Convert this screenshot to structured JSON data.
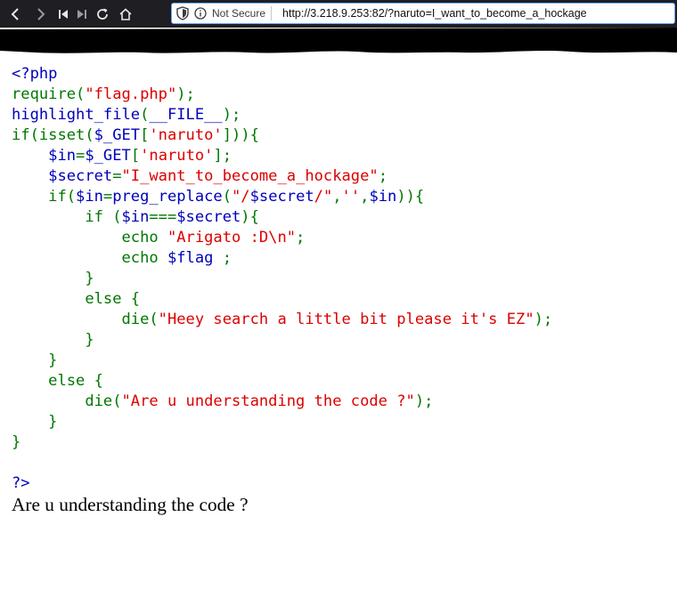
{
  "browser": {
    "security_label": "Not Secure",
    "url": "http://3.218.9.253:82/?naruto=I_want_to_become_a_hockage",
    "icons": [
      "back-icon",
      "forward-icon",
      "skip-back-icon",
      "skip-forward-icon",
      "reload-icon",
      "home-icon",
      "shield-icon",
      "info-icon"
    ],
    "colors": {
      "toolbar": "#1f1f23",
      "url_border": "#6aa7ff",
      "redaction": "#000000"
    }
  },
  "source": {
    "colors": {
      "keyword": "#007700",
      "default": "#0000bb",
      "string": "#dd0000"
    },
    "lines": [
      [
        {
          "t": "<?php",
          "c": "def"
        }
      ],
      [
        {
          "t": "require(",
          "c": "kw"
        },
        {
          "t": "\"flag.php\"",
          "c": "str"
        },
        {
          "t": ");",
          "c": "kw"
        }
      ],
      [
        {
          "t": "highlight_file",
          "c": "def"
        },
        {
          "t": "(",
          "c": "kw"
        },
        {
          "t": "__FILE__",
          "c": "def"
        },
        {
          "t": ");",
          "c": "kw"
        }
      ],
      [
        {
          "t": "if(isset(",
          "c": "kw"
        },
        {
          "t": "$_GET",
          "c": "def"
        },
        {
          "t": "[",
          "c": "kw"
        },
        {
          "t": "'naruto'",
          "c": "str"
        },
        {
          "t": "])){",
          "c": "kw"
        }
      ],
      [
        {
          "t": "    ",
          "c": "kw"
        },
        {
          "t": "$in",
          "c": "def"
        },
        {
          "t": "=",
          "c": "kw"
        },
        {
          "t": "$_GET",
          "c": "def"
        },
        {
          "t": "[",
          "c": "kw"
        },
        {
          "t": "'naruto'",
          "c": "str"
        },
        {
          "t": "];",
          "c": "kw"
        }
      ],
      [
        {
          "t": "    ",
          "c": "kw"
        },
        {
          "t": "$secret",
          "c": "def"
        },
        {
          "t": "=",
          "c": "kw"
        },
        {
          "t": "\"I_want_to_become_a_hockage\"",
          "c": "str"
        },
        {
          "t": ";",
          "c": "kw"
        }
      ],
      [
        {
          "t": "    if(",
          "c": "kw"
        },
        {
          "t": "$in",
          "c": "def"
        },
        {
          "t": "=",
          "c": "kw"
        },
        {
          "t": "preg_replace",
          "c": "def"
        },
        {
          "t": "(",
          "c": "kw"
        },
        {
          "t": "\"/",
          "c": "str"
        },
        {
          "t": "$secret",
          "c": "def"
        },
        {
          "t": "/\"",
          "c": "str"
        },
        {
          "t": ",",
          "c": "kw"
        },
        {
          "t": "''",
          "c": "str"
        },
        {
          "t": ",",
          "c": "kw"
        },
        {
          "t": "$in",
          "c": "def"
        },
        {
          "t": ")){",
          "c": "kw"
        }
      ],
      [
        {
          "t": "        if (",
          "c": "kw"
        },
        {
          "t": "$in",
          "c": "def"
        },
        {
          "t": "===",
          "c": "kw"
        },
        {
          "t": "$secret",
          "c": "def"
        },
        {
          "t": "){",
          "c": "kw"
        }
      ],
      [
        {
          "t": "            echo ",
          "c": "kw"
        },
        {
          "t": "\"Arigato :D\\n\"",
          "c": "str"
        },
        {
          "t": ";",
          "c": "kw"
        }
      ],
      [
        {
          "t": "            echo ",
          "c": "kw"
        },
        {
          "t": "$flag ",
          "c": "def"
        },
        {
          "t": ";",
          "c": "kw"
        }
      ],
      [
        {
          "t": "        }",
          "c": "kw"
        }
      ],
      [
        {
          "t": "        else {",
          "c": "kw"
        }
      ],
      [
        {
          "t": "            die(",
          "c": "kw"
        },
        {
          "t": "\"Heey search a little bit please it's EZ\"",
          "c": "str"
        },
        {
          "t": ");",
          "c": "kw"
        }
      ],
      [
        {
          "t": "        }",
          "c": "kw"
        }
      ],
      [
        {
          "t": "    }",
          "c": "kw"
        }
      ],
      [
        {
          "t": "    else {",
          "c": "kw"
        }
      ],
      [
        {
          "t": "        die(",
          "c": "kw"
        },
        {
          "t": "\"Are u understanding the code ?\"",
          "c": "str"
        },
        {
          "t": ");",
          "c": "kw"
        }
      ],
      [
        {
          "t": "    }",
          "c": "kw"
        }
      ],
      [
        {
          "t": "}",
          "c": "kw"
        }
      ],
      [
        {
          "t": "",
          "c": "kw"
        }
      ],
      [
        {
          "t": "?>",
          "c": "def"
        }
      ]
    ]
  },
  "output": {
    "text": "Are u understanding the code ?"
  }
}
